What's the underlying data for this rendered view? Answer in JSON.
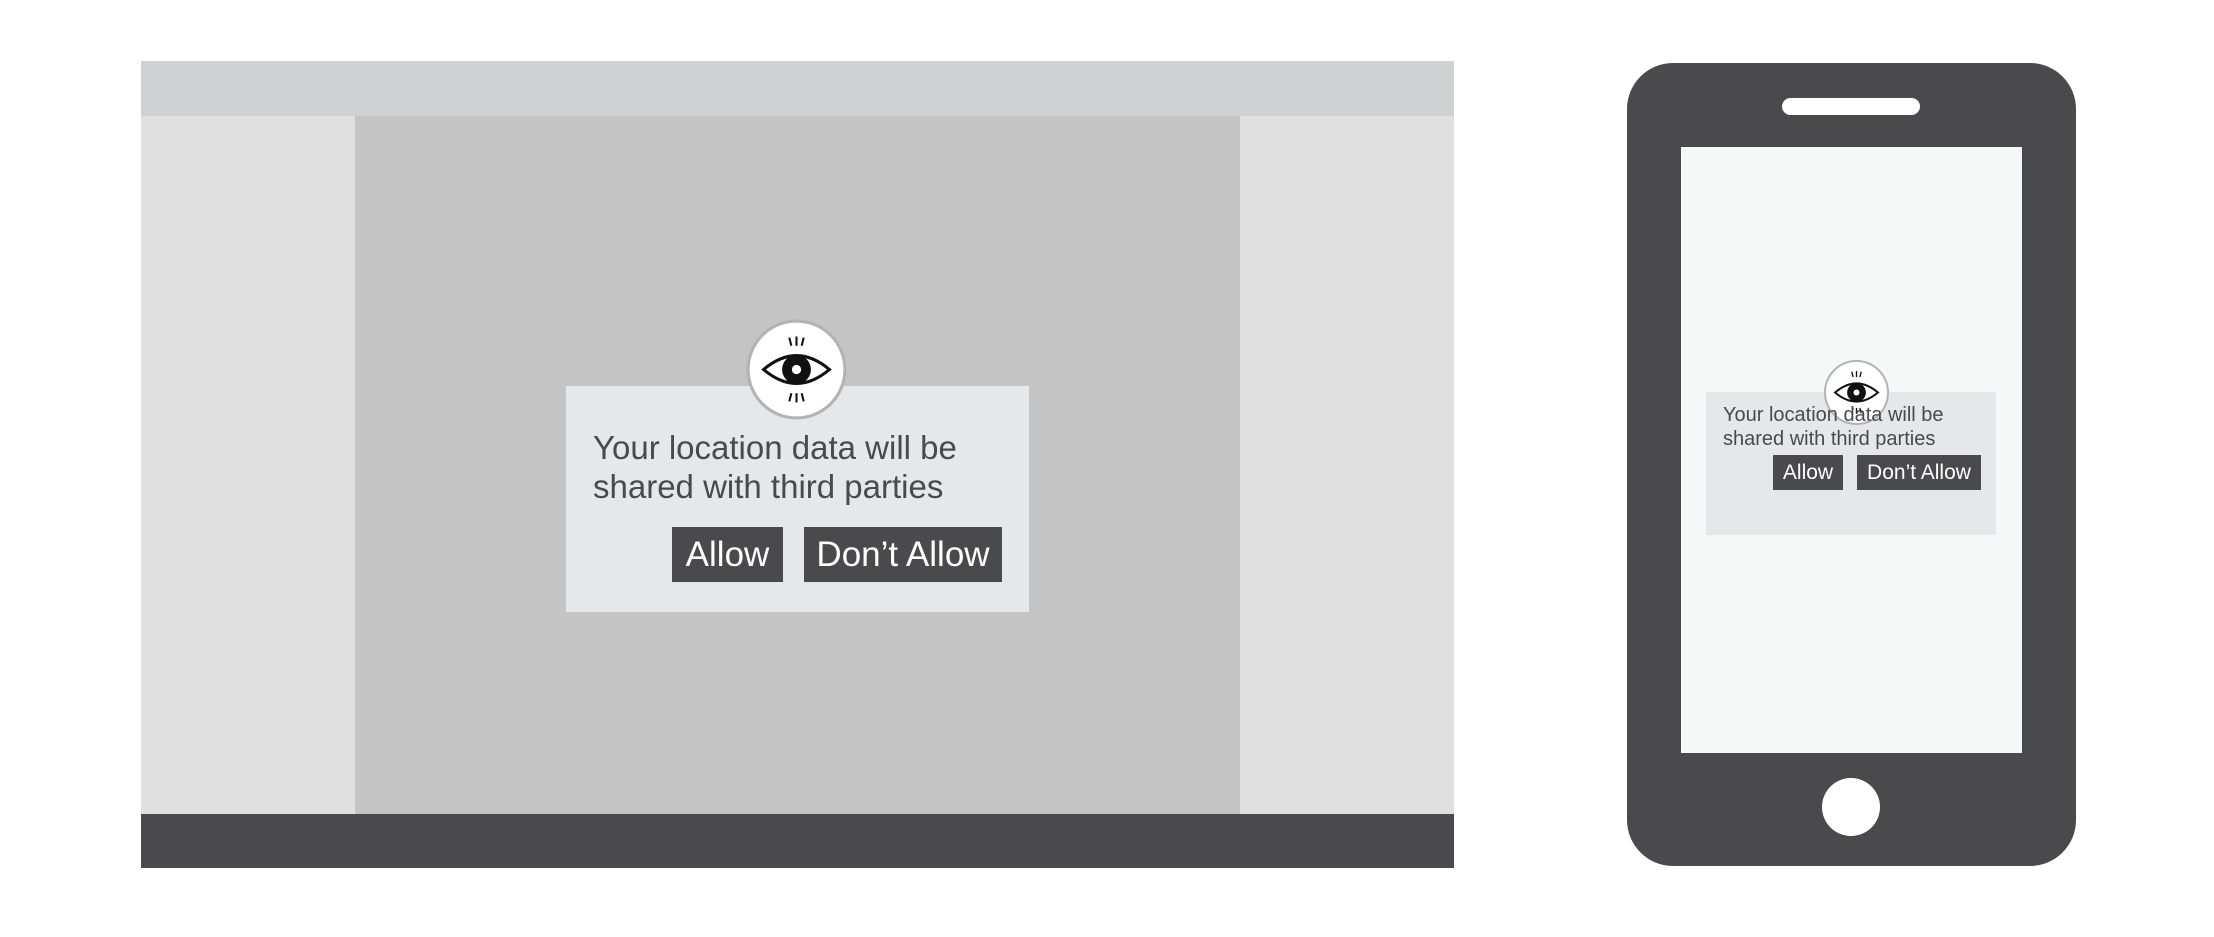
{
  "colors": {
    "background": "#ffffff",
    "browser_chrome": "#d0d1d3",
    "sidebar": "#e0e0e0",
    "content": "#c4c4c4",
    "dark": "#4a4a4c",
    "dialog": "#e6e7e8",
    "phone_screen": "#f6f7f7"
  },
  "desktop": {
    "dialog": {
      "icon": "eye-icon",
      "message_line1": "Your location data will be",
      "message_line2": "shared with third parties",
      "allow_label": "Allow",
      "deny_label": "Don’t Allow"
    }
  },
  "phone": {
    "dialog": {
      "icon": "eye-icon",
      "message_line1": "Your location data will be",
      "message_line2": "shared with third parties",
      "allow_label": "Allow",
      "deny_label": "Don’t Allow"
    }
  }
}
